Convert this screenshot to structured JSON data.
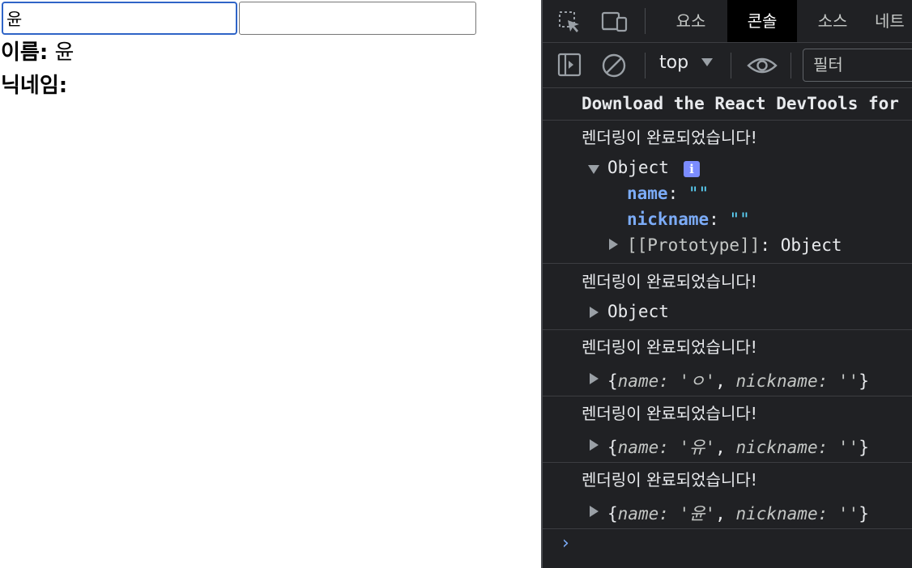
{
  "app": {
    "name_input_value": "윤",
    "nick_input_value": "",
    "name_label": "이름:",
    "name_value": "윤",
    "nick_label": "닉네임:",
    "nick_value": ""
  },
  "devtools": {
    "tabs": [
      "요소",
      "콘솔",
      "소스",
      "네트"
    ],
    "active_tab": "콘솔",
    "context": "top",
    "filter_placeholder": "필터",
    "messages": {
      "react_devtools": "Download the React DevTools for",
      "render_done": "렌더링이 완료되었습니다!"
    },
    "obj1": {
      "label": "Object",
      "info": "i",
      "name_key": "name",
      "name_val": "\"\"",
      "nick_key": "nickname",
      "nick_val": "\"\"",
      "proto": "[[Prototype]]",
      "proto_val": "Object",
      "colon": ":"
    },
    "obj2": {
      "label": "Object"
    },
    "obj3": {
      "open": "{",
      "name_key": "name:",
      "name_val": "'ㅇ'",
      "comma": ",",
      "nick_key": "nickname:",
      "nick_val": "''",
      "close": "}"
    },
    "obj4": {
      "open": "{",
      "name_key": "name:",
      "name_val": "'유'",
      "comma": ",",
      "nick_key": "nickname:",
      "nick_val": "''",
      "close": "}"
    },
    "obj5": {
      "open": "{",
      "name_key": "name:",
      "name_val": "'윤'",
      "comma": ",",
      "nick_key": "nickname:",
      "nick_val": "''",
      "close": "}"
    },
    "prompt": "›"
  },
  "colors": {
    "accent": "#2f64c7",
    "devtools_bg": "#202124",
    "key_blue": "#7cacf8",
    "string_cyan": "#5cd5fb",
    "info_badge": "#7b8cff"
  },
  "icons": [
    "inspect-element-icon",
    "device-toolbar-icon",
    "sidebar-toggle-icon",
    "clear-console-icon",
    "eye-icon",
    "triangle-right-icon",
    "triangle-down-icon"
  ]
}
